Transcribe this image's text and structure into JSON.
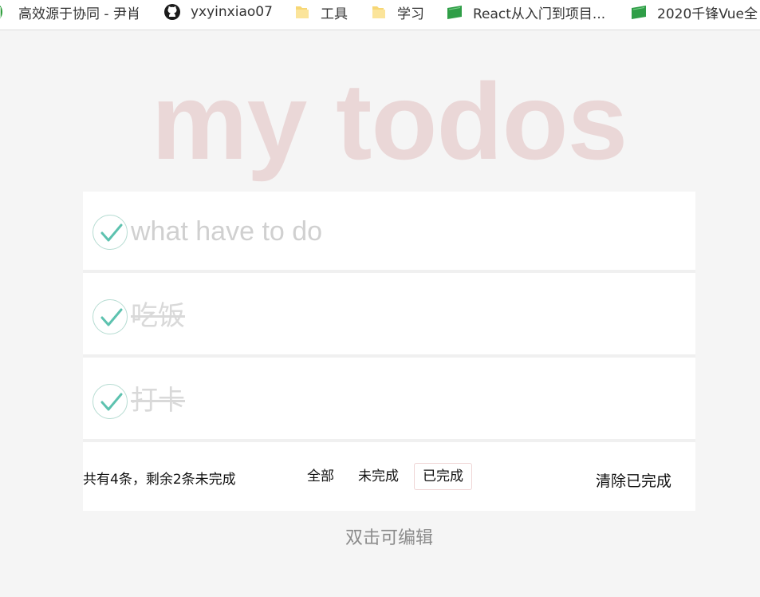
{
  "bookmarks": [
    {
      "label": "高效源于协同 - 尹肖",
      "icon": "leaf-icon"
    },
    {
      "label": "yxyinxiao07",
      "icon": "github-icon"
    },
    {
      "label": "工具",
      "icon": "folder-icon"
    },
    {
      "label": "学习",
      "icon": "folder-icon"
    },
    {
      "label": "React从入门到项目...",
      "icon": "book-icon"
    },
    {
      "label": "2020千锋Vue全",
      "icon": "book-icon"
    }
  ],
  "app": {
    "title": "my todos",
    "new_todo_placeholder": "what have to do",
    "new_todo_value": ""
  },
  "todos": [
    {
      "text": "吃饭",
      "completed": true
    },
    {
      "text": "打卡",
      "completed": true
    }
  ],
  "footer": {
    "count_text": "共有4条，剩余2条未完成",
    "filters": [
      {
        "label": "全部",
        "active": false
      },
      {
        "label": "未完成",
        "active": false
      },
      {
        "label": "已完成",
        "active": true
      }
    ],
    "clear_label": "清除已完成"
  },
  "hint": "双击可编辑",
  "colors": {
    "title": "#e9d9d9",
    "check_mark": "#5dc2af",
    "check_border": "#b6dcd2",
    "completed_text": "#d9d9d9",
    "active_filter_border": "#efd5d5",
    "page_background": "#f5f5f5"
  }
}
